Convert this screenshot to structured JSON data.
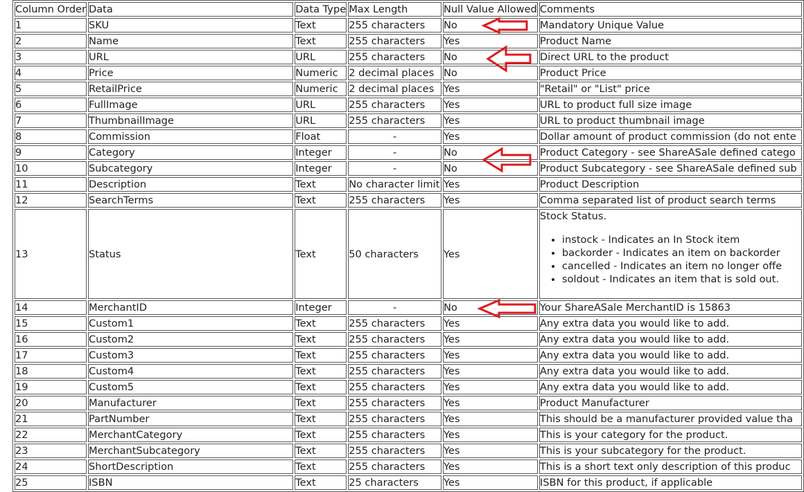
{
  "table": {
    "headers": [
      "Column Order",
      "Data",
      "Data Type",
      "Max Length",
      "Null Value Allowed",
      "Comments"
    ],
    "rows": [
      [
        "1",
        "SKU",
        "Text",
        "255 characters",
        "No",
        "Mandatory Unique Value"
      ],
      [
        "2",
        "Name",
        "Text",
        "255 characters",
        "Yes",
        "Product Name"
      ],
      [
        "3",
        "URL",
        "URL",
        "255 characters",
        "No",
        "Direct URL to the product"
      ],
      [
        "4",
        "Price",
        "Numeric",
        "2 decimal places",
        "No",
        "Product Price"
      ],
      [
        "5",
        "RetailPrice",
        "Numeric",
        "2 decimal places",
        "Yes",
        "\"Retail\" or \"List\" price"
      ],
      [
        "6",
        "FullImage",
        "URL",
        "255 characters",
        "Yes",
        "URL to product full size image"
      ],
      [
        "7",
        "ThumbnailImage",
        "URL",
        "255 characters",
        "Yes",
        "URL to product thumbnail image"
      ],
      [
        "8",
        "Commission",
        "Float",
        "-",
        "Yes",
        "Dollar amount of product commission (do not ente"
      ],
      [
        "9",
        "Category",
        "Integer",
        "-",
        "No",
        "Product Category - see ShareASale defined catego"
      ],
      [
        "10",
        "Subcategory",
        "Integer",
        "-",
        "No",
        "Product Subcategory - see ShareASale defined sub"
      ],
      [
        "11",
        "Description",
        "Text",
        "No character limit",
        "Yes",
        "Product Description"
      ],
      [
        "12",
        "SearchTerms",
        "Text",
        "255 characters",
        "Yes",
        "Comma separated list of product search terms"
      ],
      [
        "13",
        "Status",
        "Text",
        "50 characters",
        "Yes",
        "Stock Status."
      ],
      [
        "14",
        "MerchantID",
        "Integer",
        "-",
        "No",
        "Your ShareASale MerchantID is 15863"
      ],
      [
        "15",
        "Custom1",
        "Text",
        "255 characters",
        "Yes",
        "Any extra data you would like to add."
      ],
      [
        "16",
        "Custom2",
        "Text",
        "255 characters",
        "Yes",
        "Any extra data you would like to add."
      ],
      [
        "17",
        "Custom3",
        "Text",
        "255 characters",
        "Yes",
        "Any extra data you would like to add."
      ],
      [
        "18",
        "Custom4",
        "Text",
        "255 characters",
        "Yes",
        "Any extra data you would like to add."
      ],
      [
        "19",
        "Custom5",
        "Text",
        "255 characters",
        "Yes",
        "Any extra data you would like to add."
      ],
      [
        "20",
        "Manufacturer",
        "Text",
        "255 characters",
        "Yes",
        "Product Manufacturer"
      ],
      [
        "21",
        "PartNumber",
        "Text",
        "255 characters",
        "Yes",
        "This should be a manufacturer provided value tha"
      ],
      [
        "22",
        "MerchantCategory",
        "Text",
        "255 characters",
        "Yes",
        "This is your category for the product."
      ],
      [
        "23",
        "MerchantSubcategory",
        "Text",
        "255 characters",
        "Yes",
        "This is your subcategory for the product."
      ],
      [
        "24",
        "ShortDescription",
        "Text",
        "255 characters",
        "Yes",
        "This is a short text only description of this produc"
      ],
      [
        "25",
        "ISBN",
        "Text",
        "25 characters",
        "Yes",
        "ISBN for this product, if applicable"
      ]
    ],
    "status_list": [
      "instock - Indicates an In Stock item",
      "backorder - Indicates an item on backorder",
      "cancelled - Indicates an item no longer offe",
      "soldout - Indicates an item that is sold out."
    ]
  },
  "annotation_color": "#e0191e"
}
